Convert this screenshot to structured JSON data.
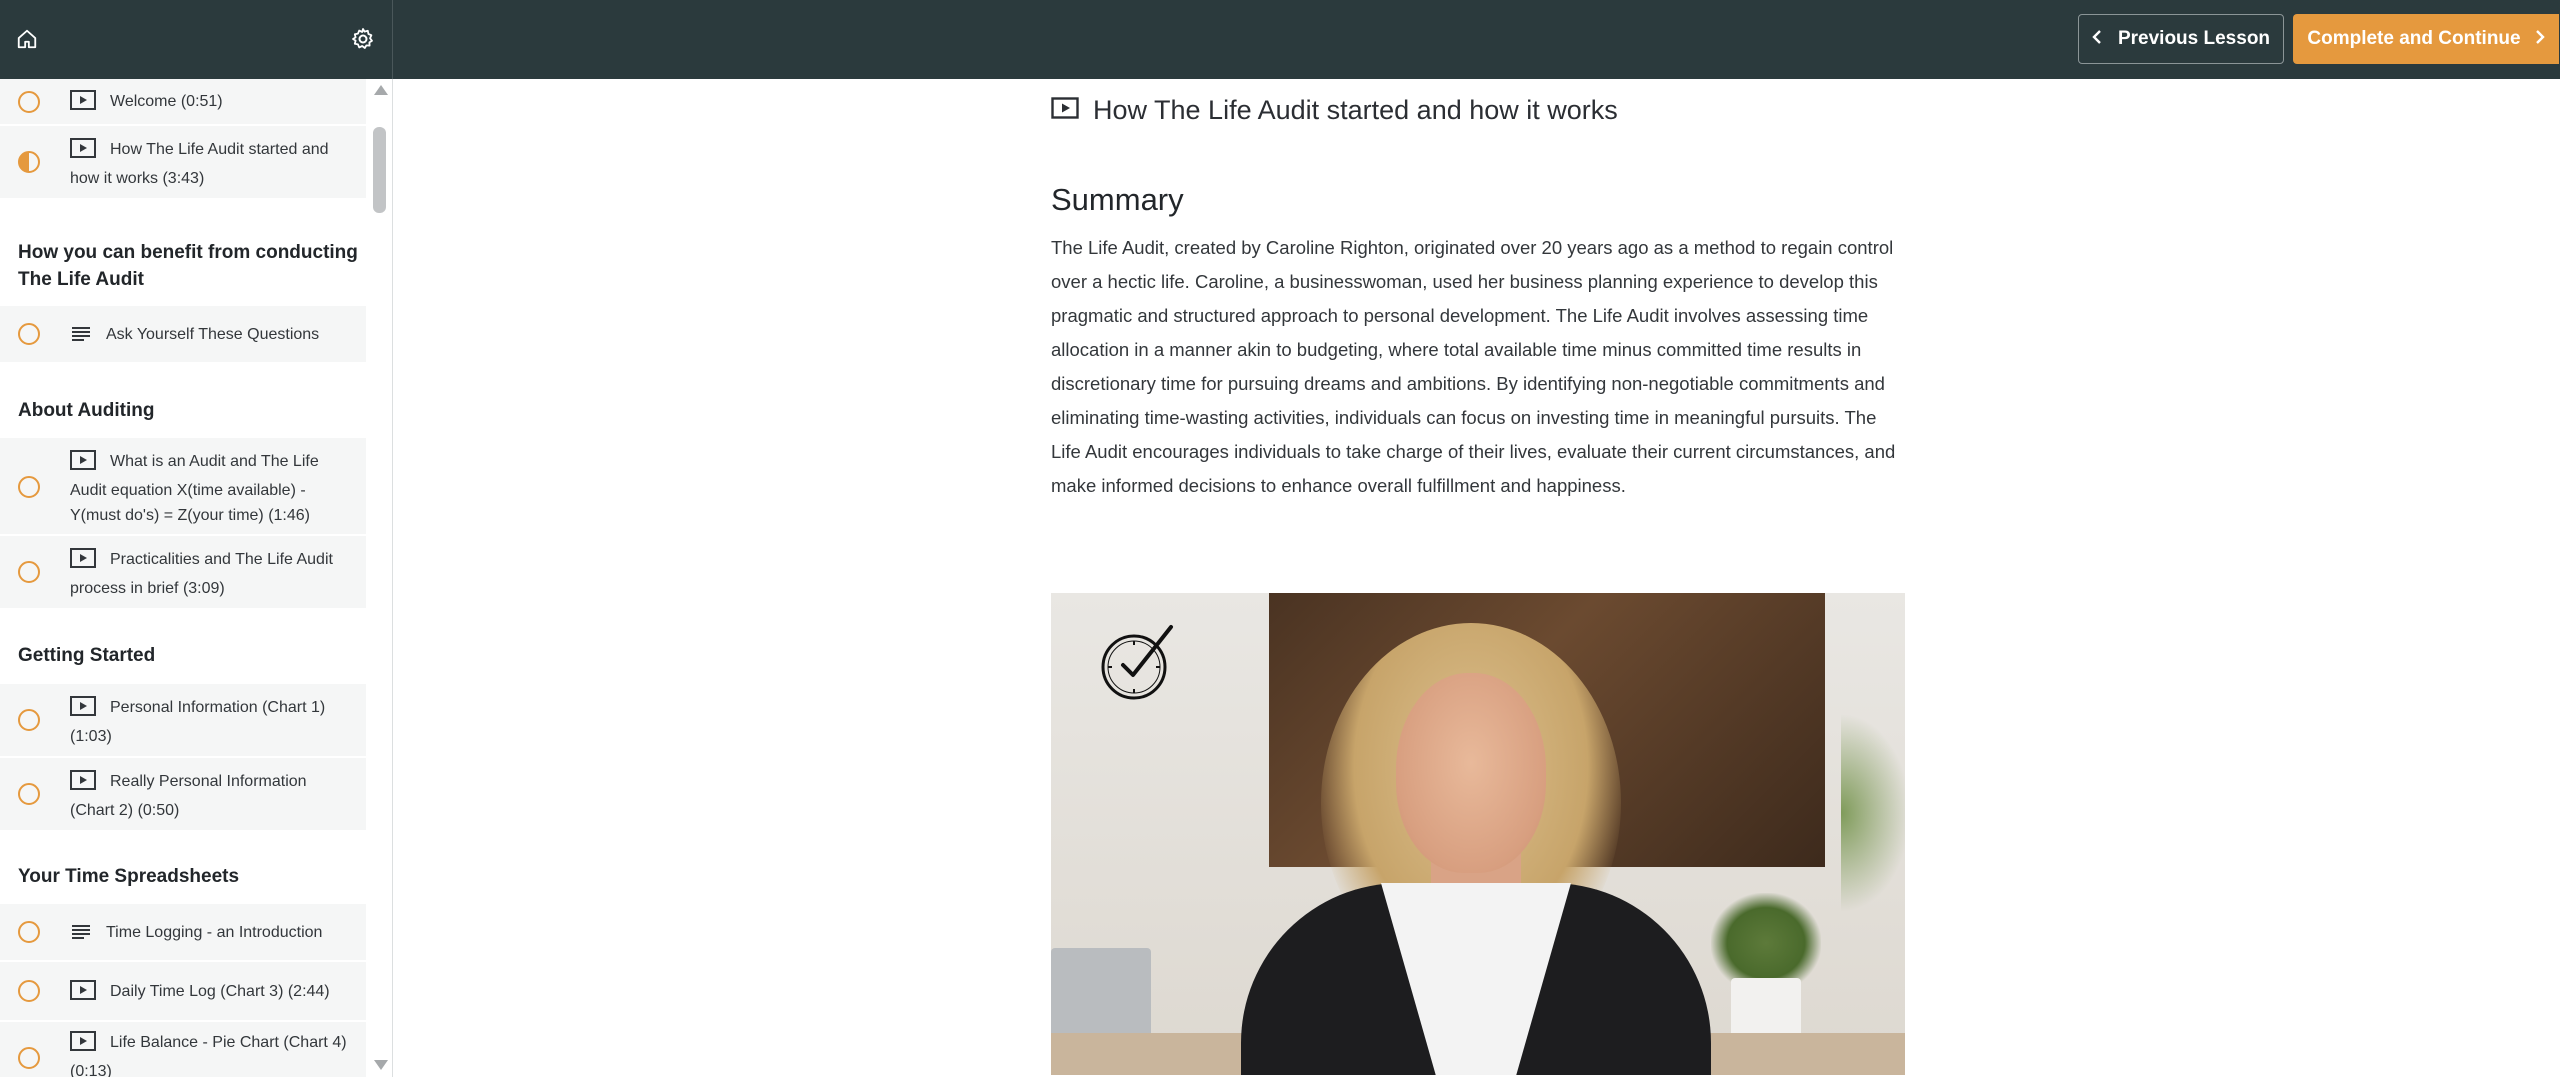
{
  "topbar": {
    "home_icon": "home-icon",
    "settings_icon": "gear-icon",
    "previous_label": "Previous Lesson",
    "next_label": "Complete and Continue",
    "accent_color": "#e5993e",
    "bar_color": "#2b3a3d"
  },
  "sidebar": {
    "items": [
      {
        "label": "Welcome (0:51)",
        "icon": "video-icon",
        "status": "not-started"
      },
      {
        "label": "How The Life Audit started and how it works (3:43)",
        "icon": "video-icon",
        "status": "in-progress"
      }
    ],
    "sections": [
      {
        "title": "How you can benefit from conducting The Life Audit",
        "items": [
          {
            "label": "Ask Yourself These Questions",
            "icon": "text-icon",
            "status": "not-started"
          }
        ]
      },
      {
        "title": "About Auditing",
        "items": [
          {
            "label": "What is an Audit and The Life Audit equation X(time available) - Y(must do's) = Z(your time) (1:46)",
            "icon": "video-icon",
            "status": "not-started"
          },
          {
            "label": "Practicalities and The Life Audit process in brief (3:09)",
            "icon": "video-icon",
            "status": "not-started"
          }
        ]
      },
      {
        "title": "Getting Started",
        "items": [
          {
            "label": "Personal Information (Chart 1) (1:03)",
            "icon": "video-icon",
            "status": "not-started"
          },
          {
            "label": "Really Personal Information (Chart 2) (0:50)",
            "icon": "video-icon",
            "status": "not-started"
          }
        ]
      },
      {
        "title": "Your Time Spreadsheets",
        "items": [
          {
            "label": "Time Logging - an Introduction",
            "icon": "text-icon",
            "status": "not-started"
          },
          {
            "label": "Daily Time Log (Chart 3) (2:44)",
            "icon": "video-icon",
            "status": "not-started"
          },
          {
            "label": "Life Balance - Pie Chart (Chart 4) (0:13)",
            "icon": "video-icon",
            "status": "not-started"
          }
        ]
      }
    ]
  },
  "main": {
    "lesson_title": "How The Life Audit started and how it works",
    "summary_heading": "Summary",
    "summary_text": "The Life Audit, created by Caroline Righton, originated over 20 years ago as a method to regain control over a hectic life. Caroline, a businesswoman, used her business planning experience to develop this pragmatic and structured approach to personal development. The Life Audit involves assessing time allocation in a manner akin to budgeting, where total available time minus committed time results in discretionary time for pursuing dreams and ambitions. By identifying non-negotiable commitments and eliminating time-wasting activities, individuals can focus on investing time in meaningful pursuits. The Life Audit encourages individuals to take charge of their lives, evaluate their current circumstances, and make informed decisions to enhance overall fulfillment and happiness.",
    "video": {
      "thumbnail": "presenter-video-thumbnail",
      "logo_icon": "clock-check-icon"
    }
  }
}
